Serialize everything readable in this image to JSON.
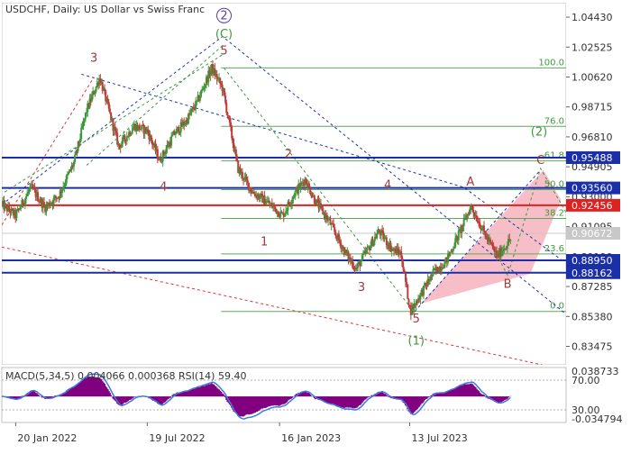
{
  "chart_data": {
    "type": "candlestick",
    "title": "USDCHF, Daily:  US Dollar vs Swiss Franc",
    "price_axis": {
      "ticks": [
        "1.04430",
        "1.02525",
        "1.00620",
        "0.98715",
        "0.96810",
        "0.94905",
        "0.93000",
        "0.91095",
        "0.89190",
        "0.87285",
        "0.85380",
        "0.83475"
      ],
      "ylim": [
        0.823,
        1.0535
      ]
    },
    "time_axis": {
      "ticks": [
        "20 Jan 2022",
        "19 Jul 2022",
        "16 Jan 2023",
        "13 Jul 2023"
      ],
      "xlim": [
        "2022-01-01",
        "2024-02-12"
      ]
    },
    "price_path": [
      [
        "2022-01-01",
        0.925
      ],
      [
        "2022-01-20",
        0.918
      ],
      [
        "2022-02-10",
        0.936
      ],
      [
        "2022-03-01",
        0.923
      ],
      [
        "2022-03-20",
        0.931
      ],
      [
        "2022-04-10",
        0.952
      ],
      [
        "2022-04-27",
        0.985
      ],
      [
        "2022-05-15",
        1.006
      ],
      [
        "2022-06-10",
        0.962
      ],
      [
        "2022-07-01",
        0.975
      ],
      [
        "2022-07-19",
        0.972
      ],
      [
        "2022-08-05",
        0.953
      ],
      [
        "2022-08-25",
        0.97
      ],
      [
        "2022-09-10",
        0.978
      ],
      [
        "2022-09-25",
        0.99
      ],
      [
        "2022-10-15",
        1.012
      ],
      [
        "2022-10-30",
        0.999
      ],
      [
        "2022-11-20",
        0.948
      ],
      [
        "2022-12-10",
        0.933
      ],
      [
        "2023-01-01",
        0.926
      ],
      [
        "2023-01-20",
        0.918
      ],
      [
        "2023-02-05",
        0.932
      ],
      [
        "2023-02-20",
        0.941
      ],
      [
        "2023-03-05",
        0.928
      ],
      [
        "2023-03-25",
        0.914
      ],
      [
        "2023-04-15",
        0.895
      ],
      [
        "2023-05-01",
        0.884
      ],
      [
        "2023-05-20",
        0.899
      ],
      [
        "2023-06-01",
        0.908
      ],
      [
        "2023-06-20",
        0.896
      ],
      [
        "2023-07-01",
        0.894
      ],
      [
        "2023-07-14",
        0.857
      ],
      [
        "2023-07-28",
        0.868
      ],
      [
        "2023-08-15",
        0.882
      ],
      [
        "2023-09-01",
        0.889
      ],
      [
        "2023-09-20",
        0.908
      ],
      [
        "2023-10-05",
        0.924
      ],
      [
        "2023-10-25",
        0.905
      ],
      [
        "2023-11-10",
        0.892
      ],
      [
        "2023-11-28",
        0.903
      ]
    ],
    "current_price": "0.90672",
    "horizontal_levels": [
      {
        "price": "0.95488",
        "color": "#1a2fa8"
      },
      {
        "price": "0.93560",
        "color": "#1a2fa8"
      },
      {
        "price": "0.92456",
        "color": "#dd2222"
      },
      {
        "price": "0.88950",
        "color": "#1a2fa8"
      },
      {
        "price": "0.88162",
        "color": "#1a2fa8"
      }
    ],
    "fibonacci": {
      "start_date": "2022-10-28",
      "end_date": "2024-02-12",
      "high": 1.012,
      "low": 0.857,
      "levels": [
        {
          "ratio": 1.0,
          "label": "100.0"
        },
        {
          "ratio": 0.76,
          "label": "76.0"
        },
        {
          "ratio": 0.618,
          "label": "61.8"
        },
        {
          "ratio": 0.5,
          "label": "50.0"
        },
        {
          "ratio": 0.382,
          "label": "38.2"
        },
        {
          "ratio": 0.236,
          "label": "23.6"
        },
        {
          "ratio": 0.0,
          "label": "0.0"
        }
      ]
    },
    "wave_labels": [
      {
        "text": "3",
        "date": "2022-05-07",
        "price": 1.016,
        "color": "#9c3b3b"
      },
      {
        "text": "4",
        "date": "2022-08-10",
        "price": 0.934,
        "color": "#9c3b3b"
      },
      {
        "text": "5",
        "date": "2022-11-01",
        "price": 1.0205,
        "color": "#9c3b3b"
      },
      {
        "text": "2",
        "date": "2023-01-28",
        "price": 0.955,
        "color": "#9c3b3b"
      },
      {
        "text": "1",
        "date": "2022-12-26",
        "price": 0.899,
        "color": "#9c3b3b"
      },
      {
        "text": "4",
        "date": "2023-06-13",
        "price": 0.935,
        "color": "#9c3b3b"
      },
      {
        "text": "3",
        "date": "2023-05-08",
        "price": 0.87,
        "color": "#9c3b3b"
      },
      {
        "text": "5",
        "date": "2023-07-22",
        "price": 0.85,
        "color": "#9c3b3b"
      },
      {
        "text": "A",
        "date": "2023-10-04",
        "price": 0.937,
        "color": "#9c3b3b"
      },
      {
        "text": "B",
        "date": "2023-11-24",
        "price": 0.872,
        "color": "#9c3b3b"
      },
      {
        "text": "C",
        "date": "2024-01-08",
        "price": 0.951,
        "color": "#9c3b3b"
      },
      {
        "text": "(1)",
        "date": "2023-07-22",
        "price": 0.836,
        "color": "#3e9a3e"
      },
      {
        "text": "(2)",
        "date": "2024-01-06",
        "price": 0.969,
        "color": "#3e9a3e"
      },
      {
        "text": "(C)",
        "date": "2022-11-01",
        "price": 1.031,
        "color": "#3e9a3e"
      },
      {
        "text": "2",
        "date": "2022-11-01",
        "price": 1.043,
        "color": "#5b3fa0",
        "circled": true
      }
    ],
    "pattern_lines": [
      {
        "style": "dotted",
        "color": "#2233aa",
        "points": [
          [
            "2022-01-01",
            0.925
          ],
          [
            "2022-10-30",
            1.032
          ],
          [
            "2024-02-10",
            0.856
          ]
        ]
      },
      {
        "style": "dotted",
        "color": "#2233aa",
        "points": [
          [
            "2022-04-20",
            1.008
          ],
          [
            "2023-09-25",
            0.936
          ],
          [
            "2024-02-05",
            0.89
          ]
        ]
      },
      {
        "style": "dotted",
        "color": "#dd3333",
        "points": [
          [
            "2022-01-01",
            0.912
          ],
          [
            "2022-05-07",
            1.006
          ]
        ]
      },
      {
        "style": "dotted",
        "color": "#dd3333",
        "points": [
          [
            "2022-01-01",
            0.898
          ],
          [
            "2024-01-10",
            0.823
          ]
        ]
      },
      {
        "style": "dotted",
        "color": "#3e9a3e",
        "points": [
          [
            "2022-01-05",
            0.933
          ],
          [
            "2022-11-01",
            1.021
          ]
        ]
      },
      {
        "style": "dotted",
        "color": "#3e9a3e",
        "points": [
          [
            "2022-04-27",
            0.95
          ],
          [
            "2022-11-01",
            1.027
          ]
        ]
      },
      {
        "style": "dotted",
        "color": "#3e9a3e",
        "points": [
          [
            "2022-11-01",
            1.012
          ],
          [
            "2023-07-20",
            0.856
          ]
        ]
      },
      {
        "style": "dotted",
        "color": "#3e9a3e",
        "points": [
          [
            "2023-10-05",
            0.924
          ],
          [
            "2023-11-24",
            0.88
          ],
          [
            "2024-01-08",
            0.948
          ],
          [
            "2024-02-12",
            0.92
          ]
        ]
      },
      {
        "style": "dotted",
        "color": "#2233aa",
        "points": [
          [
            "2023-07-20",
            0.857
          ],
          [
            "2024-01-08",
            0.947
          ]
        ]
      }
    ],
    "channel": {
      "color": "#f3a2b0",
      "points": [
        [
          "2023-07-28",
          0.862
        ],
        [
          "2024-01-12",
          0.947
        ],
        [
          "2024-02-05",
          0.928
        ],
        [
          "2023-12-25",
          0.881
        ]
      ]
    },
    "indicator": {
      "label": "MACD(5,34,5) 0.004066 0.000368 RSI(14) 59.40",
      "ticks": [
        "0.038733",
        "70.00",
        "30.00",
        "-0.034794"
      ],
      "ylim": [
        -0.0348,
        0.0387
      ],
      "histogram_color": "#800080",
      "signal_color": "#3d7be0"
    }
  }
}
